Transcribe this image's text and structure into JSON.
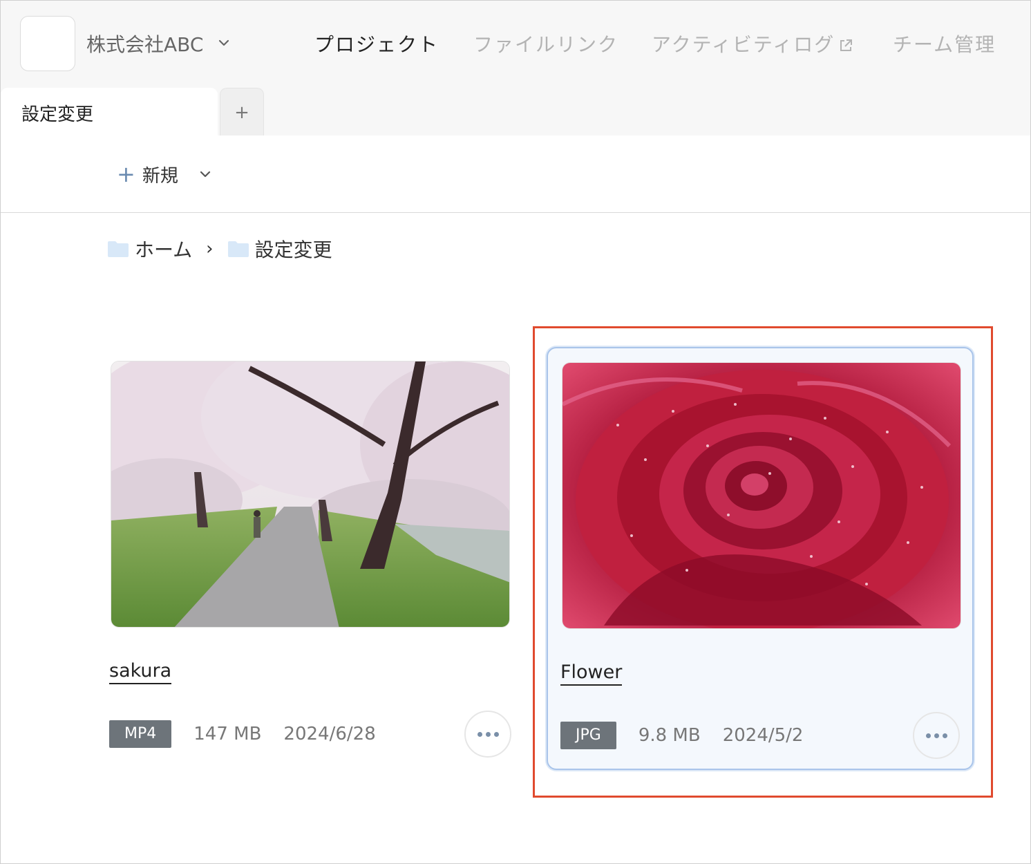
{
  "header": {
    "org_name": "株式会社ABC",
    "nav": [
      {
        "label": "プロジェクト"
      },
      {
        "label": "ファイルリンク"
      },
      {
        "label": "アクティビティログ"
      },
      {
        "label": "チーム管理"
      }
    ]
  },
  "tabs": [
    {
      "label": "設定変更"
    }
  ],
  "tab_add_label": "+",
  "toolbar": {
    "new_label": "新規"
  },
  "breadcrumb": [
    {
      "label": "ホーム"
    },
    {
      "label": "設定変更"
    }
  ],
  "breadcrumb_separator": "›",
  "files": [
    {
      "name": "sakura",
      "type": "MP4",
      "size": "147 MB",
      "date": "2024/6/28",
      "selected": false
    },
    {
      "name": "Flower",
      "type": "JPG",
      "size": "9.8 MB",
      "date": "2024/5/2",
      "selected": true
    }
  ],
  "colors": {
    "highlight": "#e04a2e",
    "selected_border": "#a9c4ea",
    "badge": "#6d747a"
  }
}
